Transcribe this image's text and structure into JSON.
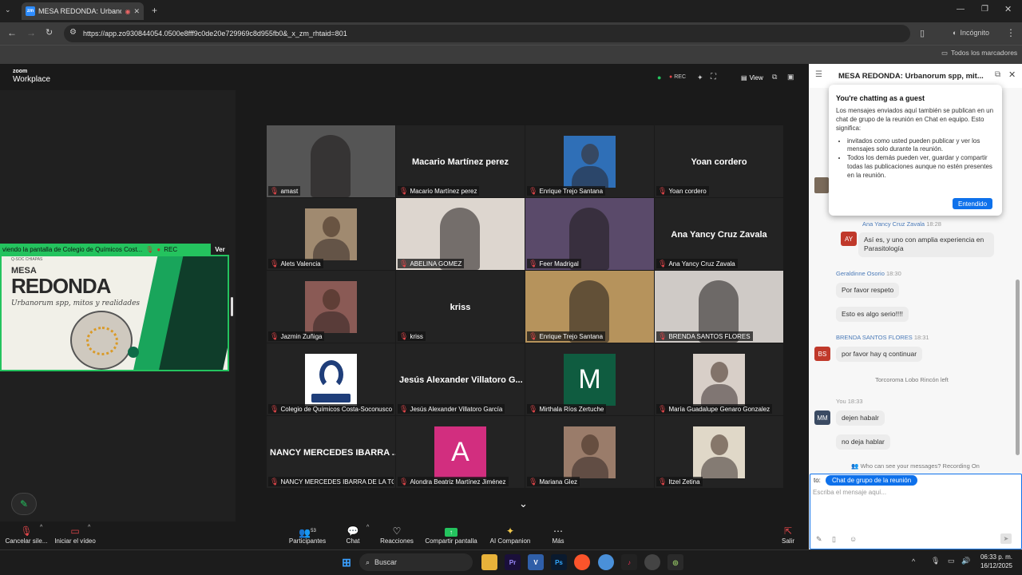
{
  "browser": {
    "tab_title": "MESA REDONDA: Urbanorum",
    "url": "https://app.zo930844054.0500e8fff9c0de20e729969c8d955fb0&_x_zm_rhtaid=801",
    "incognito_label": "Incógnito",
    "bookmarks_label": "Todos los marcadores"
  },
  "zoom": {
    "brand_top": "zoom",
    "brand_bottom": "Workplace",
    "rec": "REC",
    "view_label": "View"
  },
  "share": {
    "bar_text": "viendo la pantalla de  Colegio de Químicos Cost...",
    "rec": "REC",
    "ver": "Ver",
    "slide_top": "MESA",
    "slide_title": "REDONDA",
    "slide_sub": "Urbanorum spp, mitos y realidades",
    "slide_tiny": "Q-SOC CHIAPAS"
  },
  "participants": [
    {
      "name": "amast",
      "big": "",
      "kind": "photo",
      "color": "#555"
    },
    {
      "name": "Macario Martínez perez",
      "big": "Macario Martínez perez",
      "kind": "text",
      "color": ""
    },
    {
      "name": "Enrique Trejo Santana",
      "big": "",
      "kind": "avatar",
      "color": "#2f6fb7"
    },
    {
      "name": "Yoan cordero",
      "big": "Yoan cordero",
      "kind": "text",
      "color": ""
    },
    {
      "name": "Alets Valencia",
      "big": "",
      "kind": "avatar",
      "color": "#a08a70"
    },
    {
      "name": "ABELINA GOMEZ",
      "big": "",
      "kind": "video",
      "color": "#ddd6cf"
    },
    {
      "name": "Feer Madrigal",
      "big": "",
      "kind": "video",
      "color": "#5a4a6a"
    },
    {
      "name": "Ana Yancy Cruz Zavala",
      "big": "Ana Yancy Cruz Zavala",
      "kind": "text",
      "color": ""
    },
    {
      "name": "Jazmin Zuñiga",
      "big": "",
      "kind": "avatar",
      "color": "#8a5a55"
    },
    {
      "name": "kriss",
      "big": "kriss",
      "kind": "text",
      "color": ""
    },
    {
      "name": "Enrique Trejo Santana",
      "big": "",
      "kind": "video",
      "color": "#b6935c"
    },
    {
      "name": "BRENDA SANTOS FLORES",
      "big": "",
      "kind": "video",
      "color": "#cfcac6"
    },
    {
      "name": "Colegio de Químicos Costa-Soconusco",
      "big": "",
      "kind": "logo",
      "color": "#ffffff"
    },
    {
      "name": "Jesús Alexander Villatoro García",
      "big": "Jesús Alexander Villatoro G...",
      "kind": "text",
      "color": ""
    },
    {
      "name": "Mirthala Ríos Zertuche",
      "big": "M",
      "kind": "letter",
      "color": "#0f5c40"
    },
    {
      "name": "María Guadalupe Genaro Gonzalez",
      "big": "",
      "kind": "avatar",
      "color": "#d8cfc8"
    },
    {
      "name": "NANCY MERCEDES IBARRA DE LA TO...",
      "big": "NANCY MERCEDES IBARRA ...",
      "kind": "text",
      "color": ""
    },
    {
      "name": "Alondra Beatriz Martínez Jiménez",
      "big": "A",
      "kind": "letter",
      "color": "#d22e7f"
    },
    {
      "name": "Mariana Glez",
      "big": "",
      "kind": "avatar",
      "color": "#9a7c6a"
    },
    {
      "name": "Itzel Zetina",
      "big": "",
      "kind": "avatar",
      "color": "#e0d8c8"
    }
  ],
  "toolbar": {
    "mute_label": "Cancelar sile...",
    "video_label": "Iniciar el vídeo",
    "participants_label": "Participantes",
    "participants_count": "53",
    "chat_label": "Chat",
    "reactions_label": "Reacciones",
    "share_label": "Compartir pantalla",
    "ai_label": "AI Companion",
    "more_label": "Más",
    "leave_label": "Salir"
  },
  "chat": {
    "title": "MESA REDONDA: Urbanorum spp, mit...",
    "guest_title": "You're chatting as a guest",
    "guest_body": "Los mensajes enviados aquí también se publican en un chat de grupo de la reunión en Chat en equipo. Esto significa:",
    "guest_b1": "invitados como usted pueden publicar y ver los mensajes solo durante la reunión.",
    "guest_b2": "Todos los demás pueden ver, guardar y compartir todas las publicaciones aunque no estén presentes en la reunión.",
    "ok": "Entendido",
    "s1": "Ana Yancy Cruz Zavala",
    "s1_time": "18:28",
    "m1": "Así es, y uno con amplia experiencia en Parasitología",
    "av1": "AY",
    "s2": "Geraldinne Osorio",
    "s2_time": "18:30",
    "m2a": "Por favor respeto",
    "m2b": "Esto es algo serio!!!!",
    "s3": "BRENDA SANTOS FLORES",
    "s3_time": "18:31",
    "m3": "por favor hay q continuar",
    "av3": "BS",
    "left_notice": "Torcoroma Lobo Rincón left",
    "s4": "You",
    "s4_time": "18:33",
    "av4": "MM",
    "m4a": "dejen habalr",
    "m4b": "no deja hablar",
    "who_sees": "Who can see your messages? Recording On",
    "to_label": "to:",
    "to_target": "Chat de grupo de la reunión",
    "placeholder": "Escriba el mensaje aquí..."
  },
  "taskbar": {
    "search": "Buscar",
    "time": "06:33 p. m.",
    "date": "16/12/2025"
  }
}
